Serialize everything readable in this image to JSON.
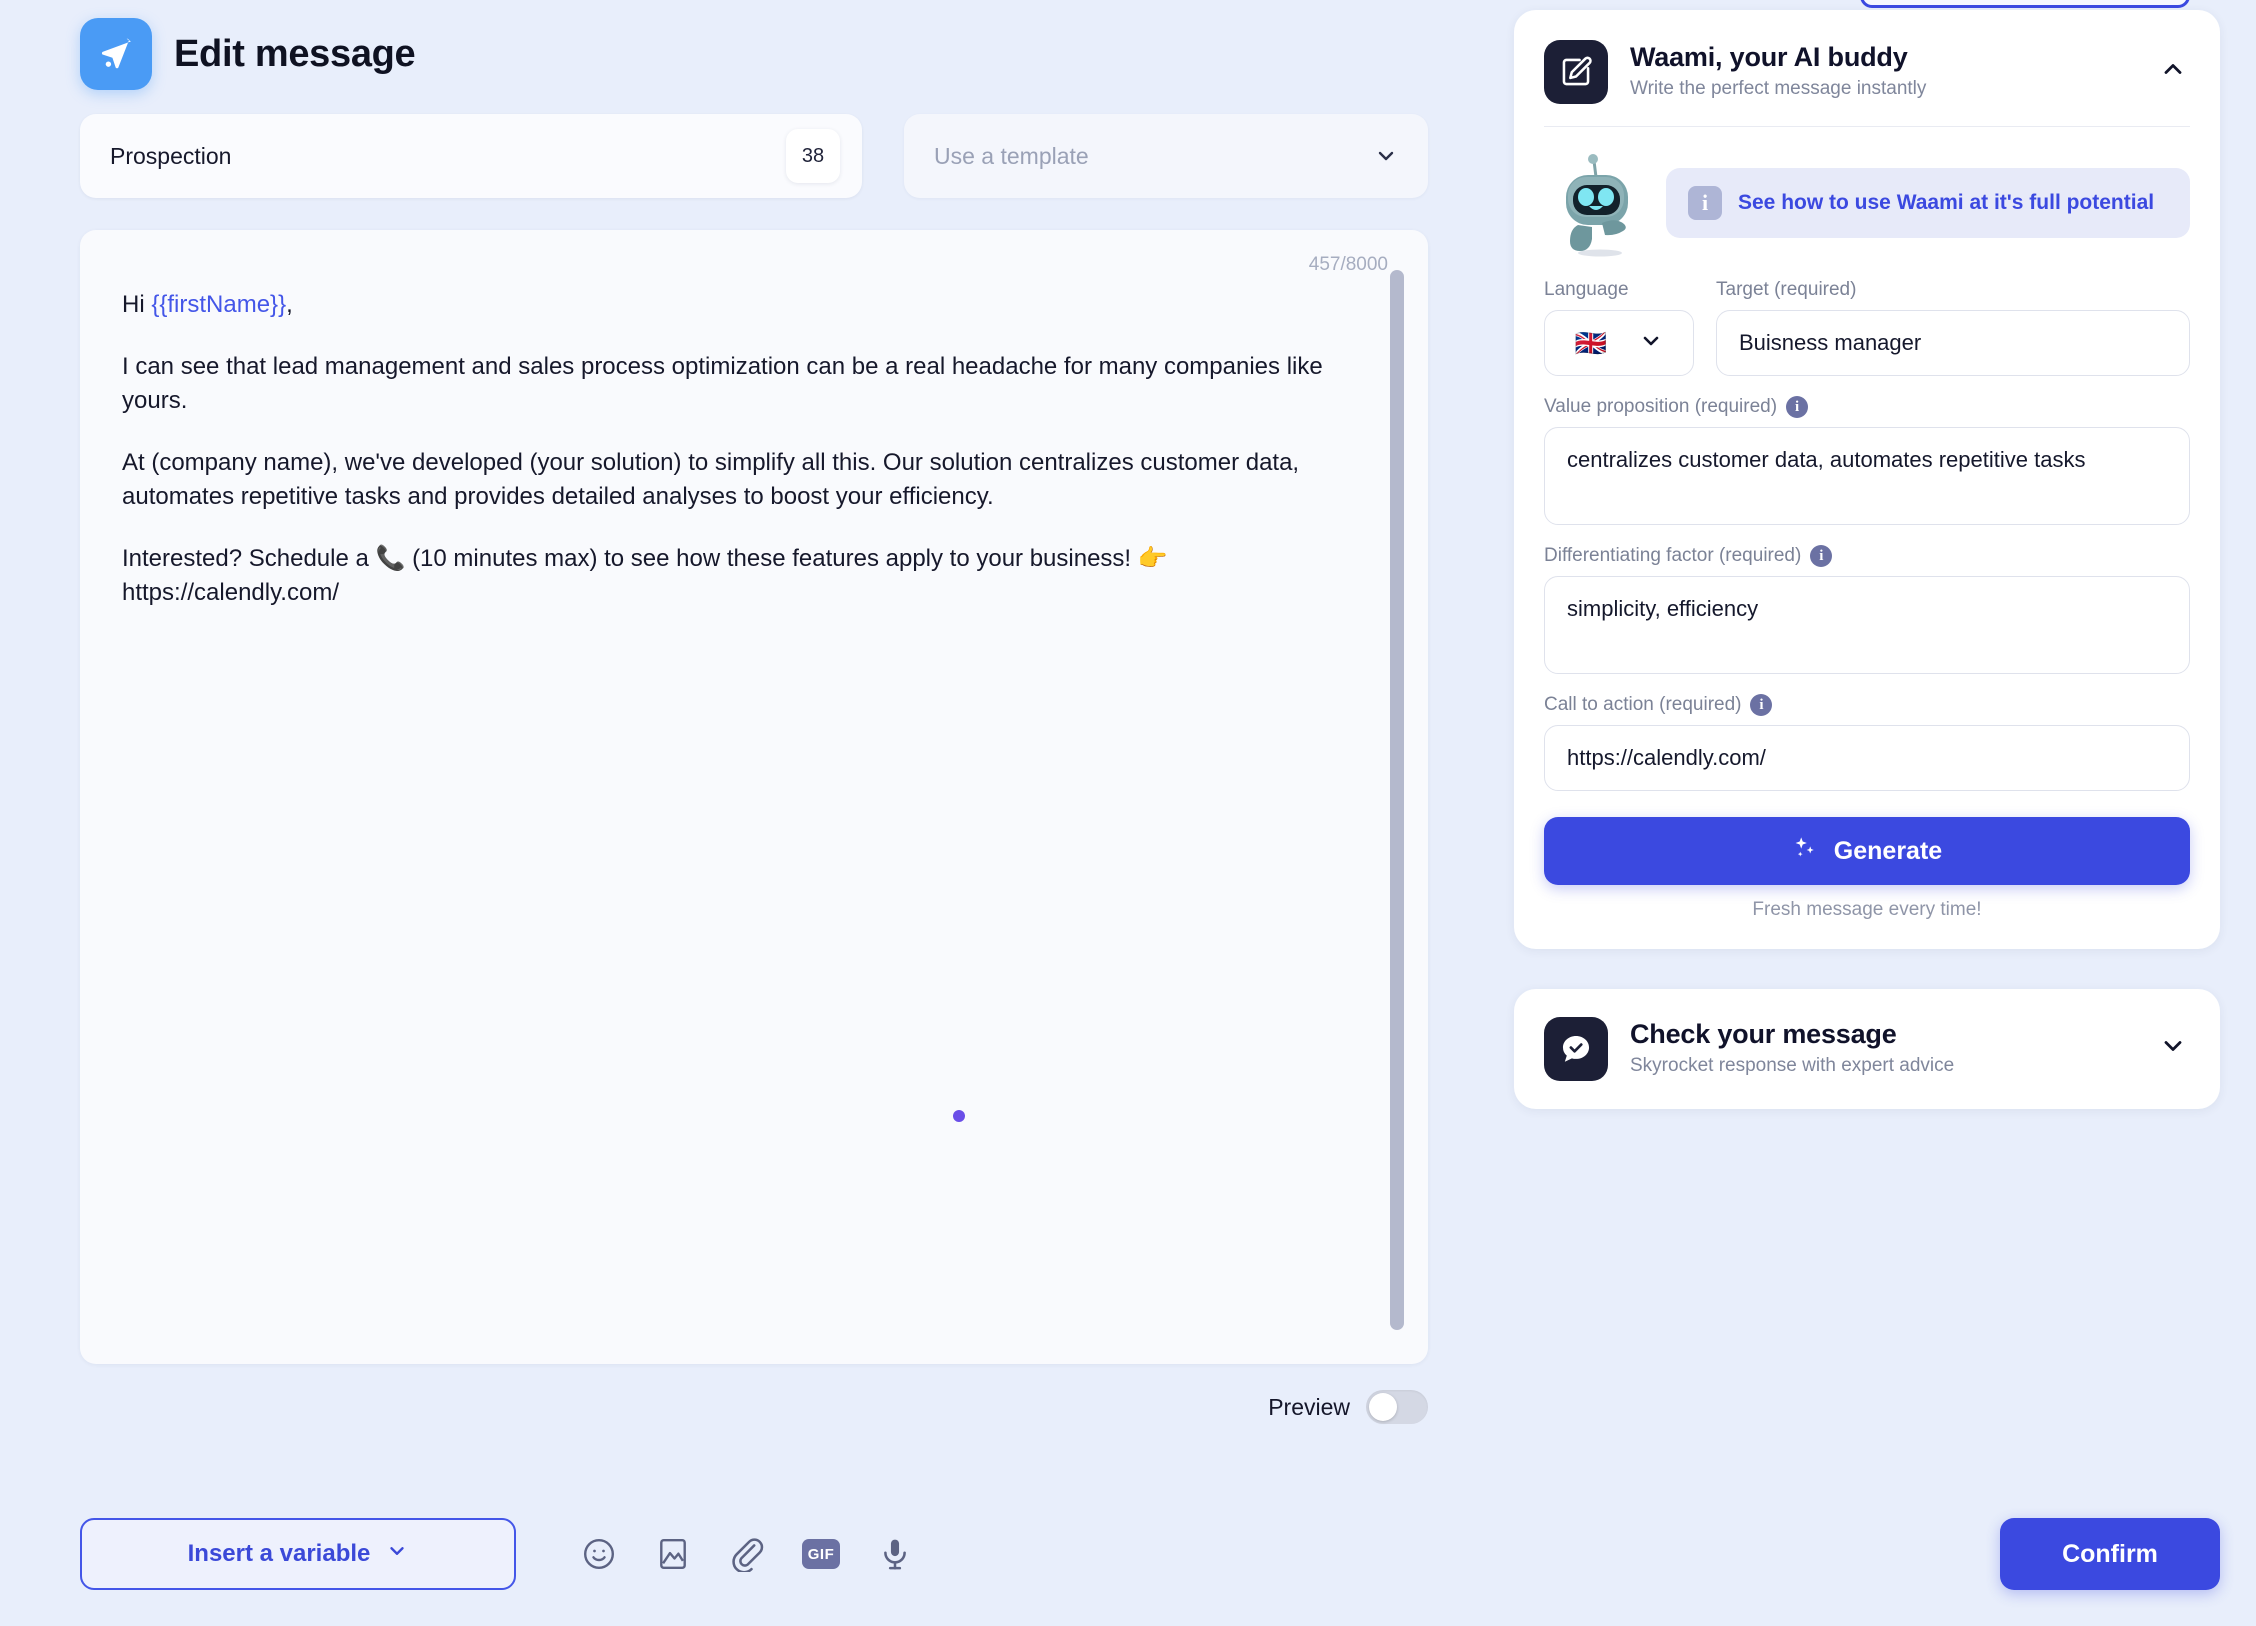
{
  "page": {
    "title": "Edit message",
    "title_icon": "send-plane-icon"
  },
  "meta": {
    "message_name": "Prospection",
    "name_badge_count": "38",
    "template_placeholder": "Use a template",
    "template_chevron_icon": "chevron-down-icon"
  },
  "editor": {
    "char_count": "457/8000",
    "greeting_prefix": "Hi ",
    "greeting_variable": "{{firstName}}",
    "greeting_suffix": ",",
    "paragraph_2": "I can see that lead management and sales process optimization can be a real headache for many companies like yours.",
    "paragraph_3": "At (company name), we've developed (your solution) to simplify all this. Our solution centralizes customer data, automates repetitive tasks and provides detailed analyses to boost your efficiency.",
    "paragraph_4": "Interested? Schedule a 📞 (10 minutes max) to see how these features apply to your business! 👉 https://calendly.com/"
  },
  "preview": {
    "label": "Preview",
    "enabled": false
  },
  "bottom_bar": {
    "insert_variable_label": "Insert a variable",
    "insert_variable_chevron": "chevron-down-icon",
    "tools": [
      {
        "name": "emoji-icon",
        "label": "Emoji"
      },
      {
        "name": "image-icon",
        "label": "Image"
      },
      {
        "name": "attachment-icon",
        "label": "Attachment"
      },
      {
        "name": "gif-icon",
        "label": "GIF"
      },
      {
        "name": "microphone-icon",
        "label": "Voice note"
      }
    ],
    "gif_label": "GIF",
    "confirm_label": "Confirm"
  },
  "waami": {
    "icon": "compose-pencil-icon",
    "title": "Waami, your AI buddy",
    "subtitle": "Write the perfect message instantly",
    "collapse_icon": "chevron-up-icon",
    "mascot": "robot-mascot",
    "promo_info_icon": "info-icon",
    "promo_text": "See how to use Waami at it's full potential",
    "language_label": "Language",
    "language_flag": "🇬🇧",
    "language_chevron": "chevron-down-icon",
    "target_label": "Target (required)",
    "target_value": "Buisness manager",
    "value_prop_label": "Value proposition (required)",
    "value_prop_info_icon": "info-icon",
    "value_prop_value": "centralizes customer data, automates repetitive tasks",
    "differentiator_label": "Differentiating factor (required)",
    "differentiator_info_icon": "info-icon",
    "differentiator_value": "simplicity, efficiency",
    "cta_label": "Call to action (required)",
    "cta_info_icon": "info-icon",
    "cta_value": "https://calendly.com/",
    "generate_label": "Generate",
    "generate_icon": "sparkles-icon",
    "fresh_note": "Fresh message every time!"
  },
  "check_message": {
    "icon": "chat-check-icon",
    "title": "Check your message",
    "subtitle": "Skyrocket response with expert advice",
    "expand_icon": "chevron-down-icon"
  },
  "colors": {
    "page_background": "#e8eefb",
    "accent_blue": "#3b49e0",
    "header_icon_blue": "#4a9bf5",
    "card_dark": "#1c1f36",
    "variable_token": "#4456e8"
  }
}
